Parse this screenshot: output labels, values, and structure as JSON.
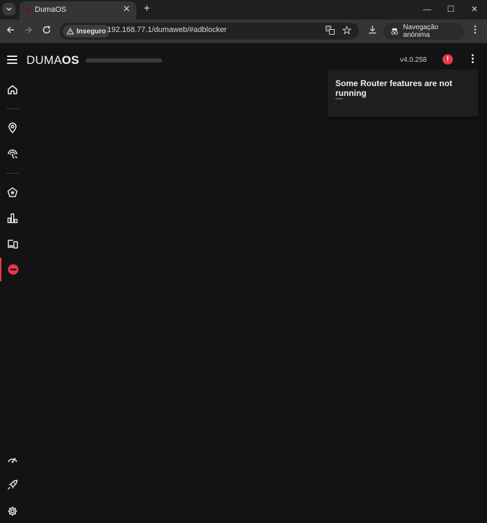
{
  "browser": {
    "tab_title": "DumaOS",
    "close_glyph": "✕",
    "newtab_glyph": "+",
    "window_controls": [
      "—",
      "☐",
      "✕"
    ],
    "security_label": "Inseguro",
    "url": "192.168.77.1/dumaweb/#adblocker",
    "incognito_label": "Navegação anónima",
    "icons": [
      "back-icon",
      "forward-icon",
      "reload-icon",
      "translate-icon",
      "star-icon",
      "download-icon",
      "incognito-icon",
      "menu-icon"
    ]
  },
  "app": {
    "logo_regular": "DUMA",
    "logo_bold": "OS",
    "version": "v4.0.258",
    "alert_glyph": "!",
    "accent": "#e63a4a"
  },
  "sidebar": {
    "items": [
      {
        "icon": "home-icon"
      },
      {
        "icon": "geo-filter-icon"
      },
      {
        "icon": "ping-heatmap-icon"
      },
      {
        "icon": "qos-icon"
      },
      {
        "icon": "network-monitor-icon"
      },
      {
        "icon": "devices-icon"
      },
      {
        "icon": "ad-blocker-icon",
        "active": true
      },
      {
        "icon": "speedtest-icon"
      },
      {
        "icon": "boost-icon"
      },
      {
        "icon": "settings-icon"
      }
    ]
  },
  "notification": {
    "heading": "Some Router features are not running",
    "sub": "—"
  }
}
